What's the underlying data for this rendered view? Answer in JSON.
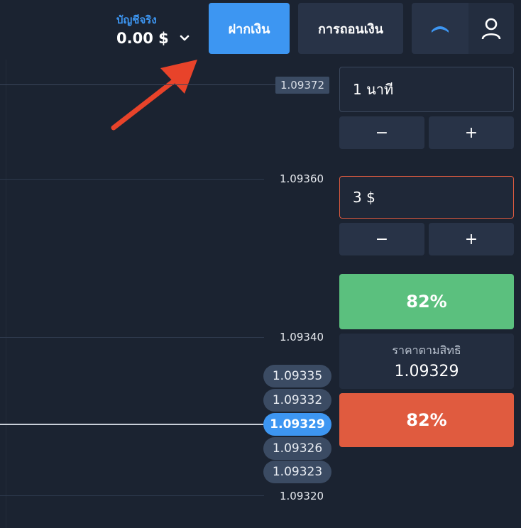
{
  "account": {
    "type_label": "บัญชีจริง",
    "balance": "0.00 $"
  },
  "header": {
    "deposit_label": "ฝากเงิน",
    "withdraw_label": "การถอนเงิน"
  },
  "chart": {
    "current_price_tag": "1.09372",
    "axis_labels": [
      "1.09360",
      "1.09340",
      "1.09320"
    ],
    "price_pills": [
      "1.09335",
      "1.09332",
      "1.09329",
      "1.09326",
      "1.09323"
    ],
    "active_pill": "1.09329"
  },
  "trade": {
    "time_value": "1 นาที",
    "amount_value": "3 $",
    "minus": "−",
    "plus": "+",
    "up_payout": "82%",
    "down_payout": "82%",
    "strike_label": "ราคาตามสิทธิ",
    "strike_value": "1.09329"
  },
  "colors": {
    "accent": "#3d96f2",
    "up": "#5bc07e",
    "down": "#e05b3f",
    "background": "#1b2331"
  },
  "icons": {
    "chevron": "chevron-down-icon",
    "chart_toggle": "chart-type-icon",
    "user": "user-icon"
  }
}
